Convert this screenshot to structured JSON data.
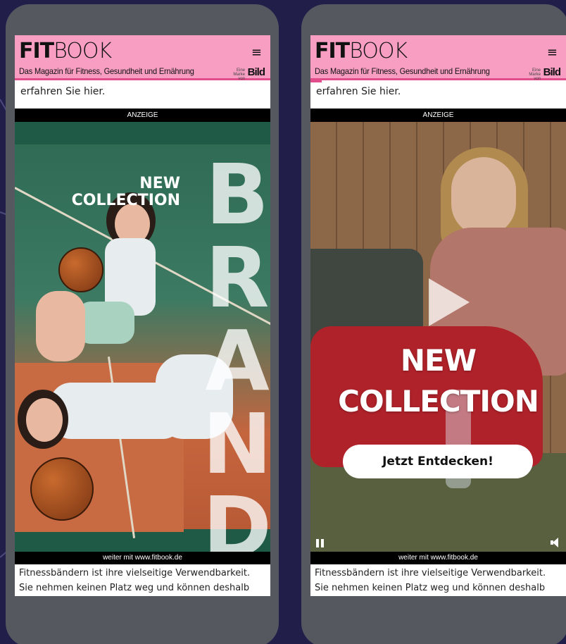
{
  "site": {
    "logo_bold": "FIT",
    "logo_light": "BOOK",
    "tagline": "Das Magazin für Fitness, Gesundheit und Ernährung",
    "menu_icon": "≡",
    "marke_line1": "Eine",
    "marke_line2": "Marke",
    "marke_line3": "von",
    "bild": "Bild"
  },
  "article": {
    "intro_text": "erfahren Sie hier.",
    "body_line1": "Fitnessbändern ist ihre vielseitige Verwendbarkeit.",
    "body_line2": "Sie nehmen keinen Platz weg und können deshalb"
  },
  "ad": {
    "label": "ANZEIGE",
    "footer": "weiter mit www.fitbook.de"
  },
  "left_ad": {
    "headline_line1": "NEW",
    "headline_line2": "COLLECTION",
    "brand_word": "BRAND"
  },
  "right_ad": {
    "headline_line1": "NEW",
    "headline_line2": "COLLECTION",
    "cta": "Jetzt Entdecken!"
  },
  "colors": {
    "background": "#211f4a",
    "header_pink": "#f79ec2",
    "accent_pink": "#e14c8a",
    "phone_frame": "#56585f"
  }
}
